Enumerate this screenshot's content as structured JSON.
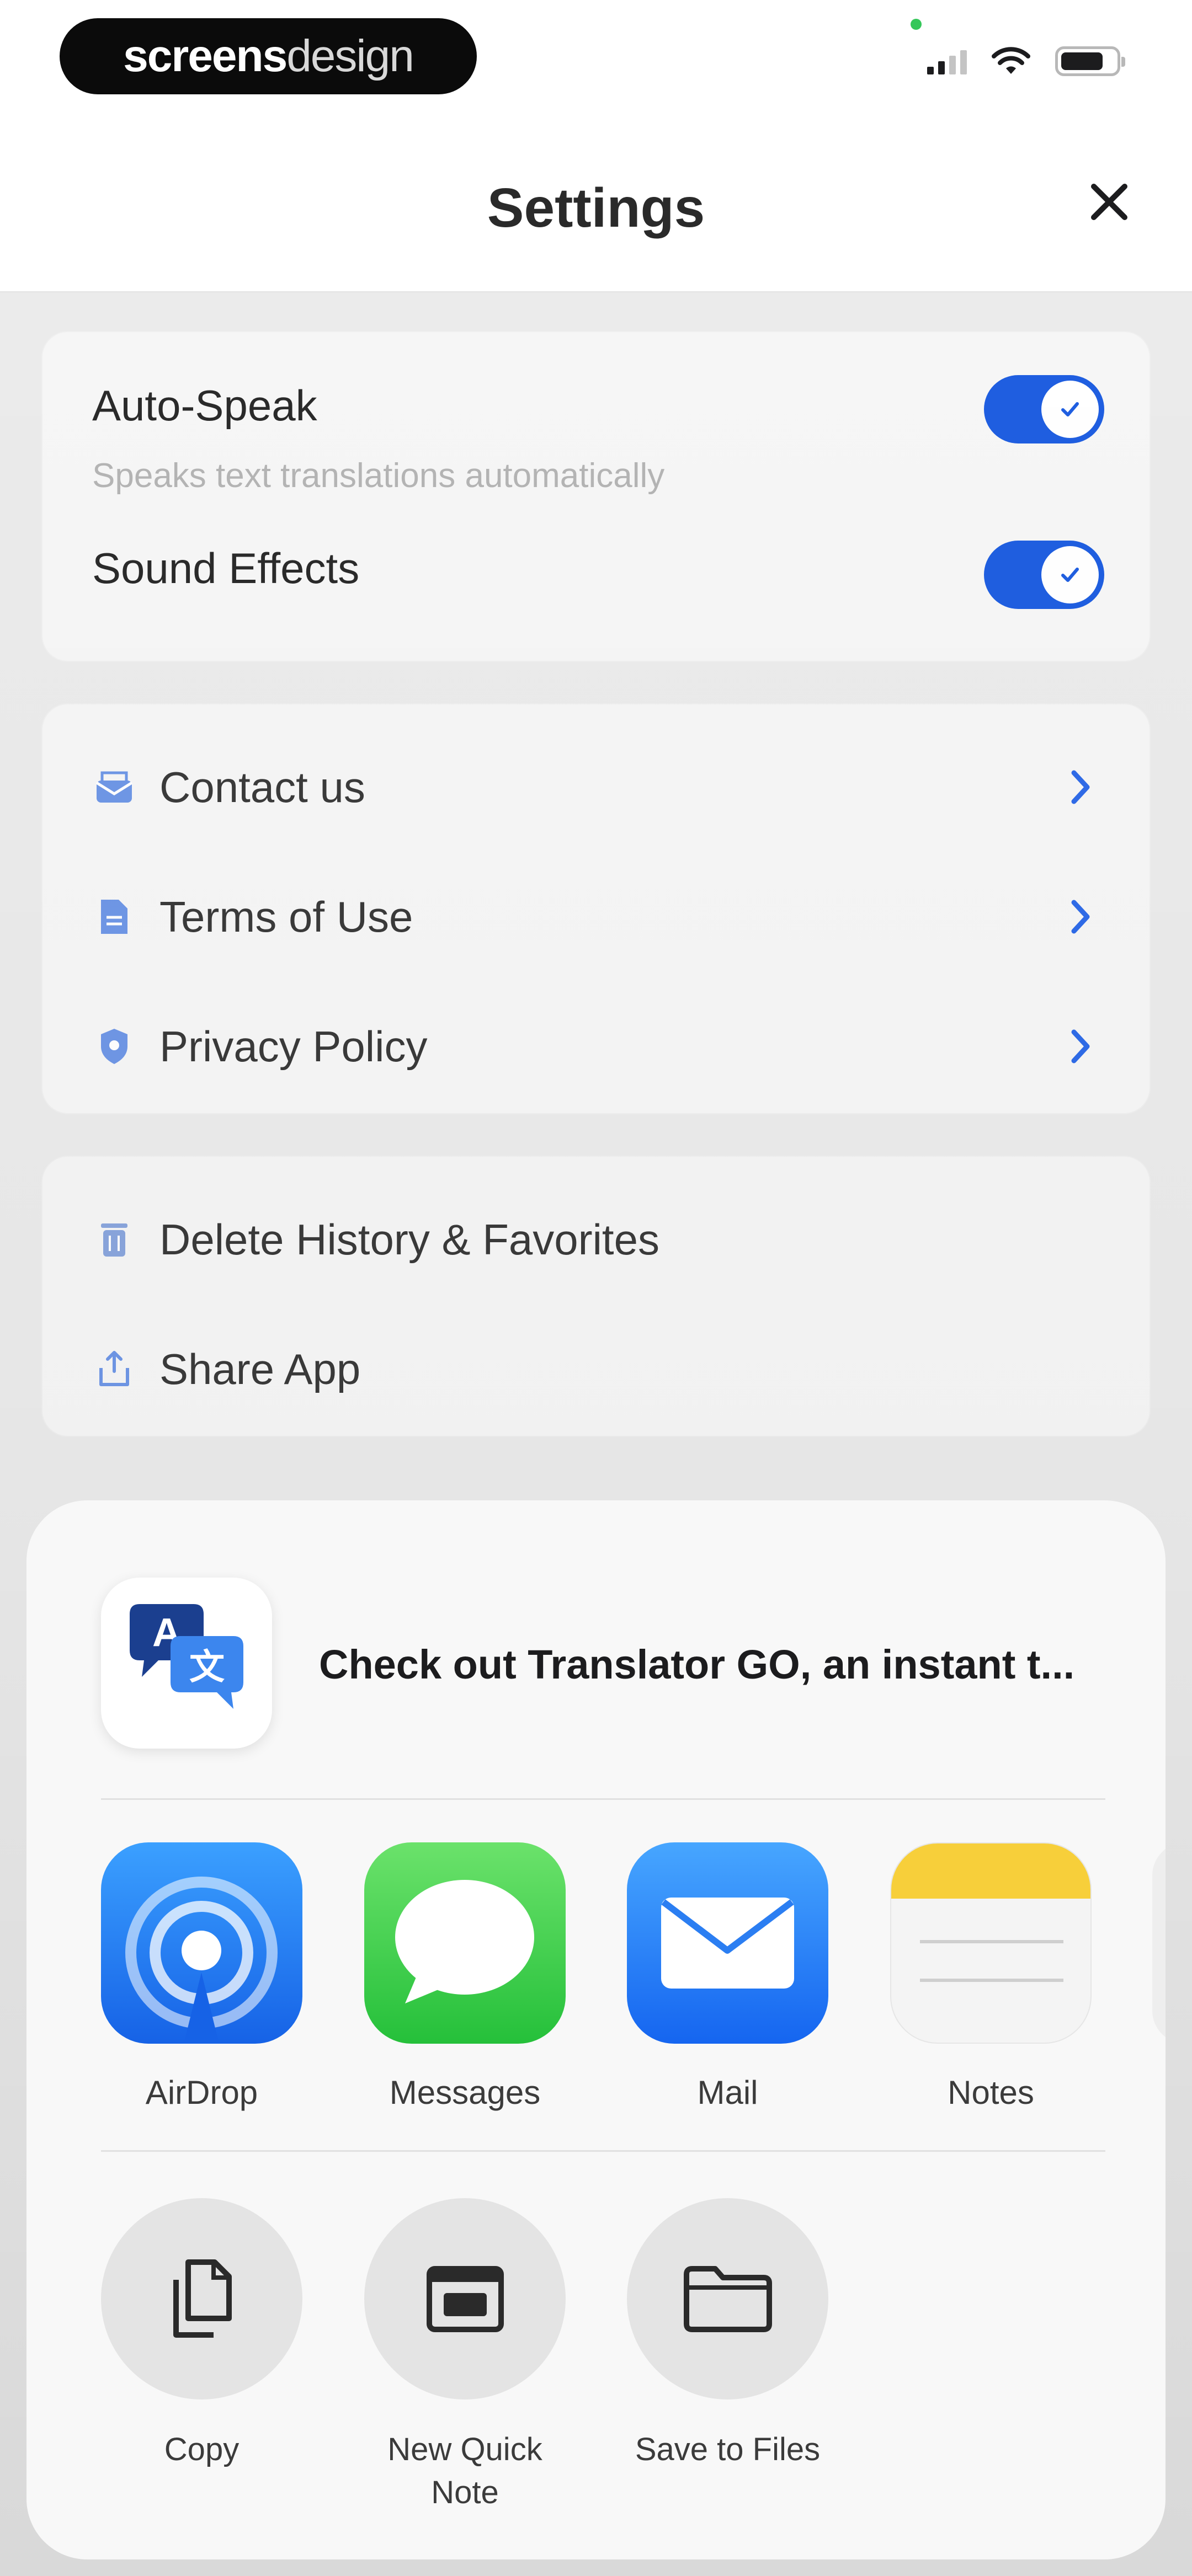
{
  "status_bar": {
    "watermark_bold": "screens",
    "watermark_light": "design"
  },
  "header": {
    "title": "Settings"
  },
  "toggles": [
    {
      "label": "Auto-Speak",
      "sublabel": "Speaks text translations automatically",
      "on": true
    },
    {
      "label": "Sound Effects",
      "on": true
    }
  ],
  "links": [
    {
      "label": "Contact us",
      "icon": "mail-icon"
    },
    {
      "label": "Terms of Use",
      "icon": "document-icon"
    },
    {
      "label": "Privacy Policy",
      "icon": "shield-icon"
    }
  ],
  "actions": [
    {
      "label": "Delete History & Favorites",
      "icon": "trash-icon"
    },
    {
      "label": "Share App",
      "icon": "share-icon"
    }
  ],
  "share_sheet": {
    "preview_text": "Check out Translator GO, an instant t...",
    "app_icon": "translator-app-icon",
    "targets": [
      {
        "label": "AirDrop",
        "icon": "airdrop-icon"
      },
      {
        "label": "Messages",
        "icon": "messages-icon"
      },
      {
        "label": "Mail",
        "icon": "mail-app-icon"
      },
      {
        "label": "Notes",
        "icon": "notes-icon"
      }
    ],
    "actions": [
      {
        "label": "Copy",
        "icon": "copy-icon"
      },
      {
        "label": "New Quick Note",
        "icon": "quick-note-icon"
      },
      {
        "label": "Save to Files",
        "icon": "folder-icon"
      }
    ]
  },
  "colors": {
    "accent": "#1f5ee0",
    "card_background": "#f6f6f6",
    "sheet_background": "#f8f8f8"
  }
}
